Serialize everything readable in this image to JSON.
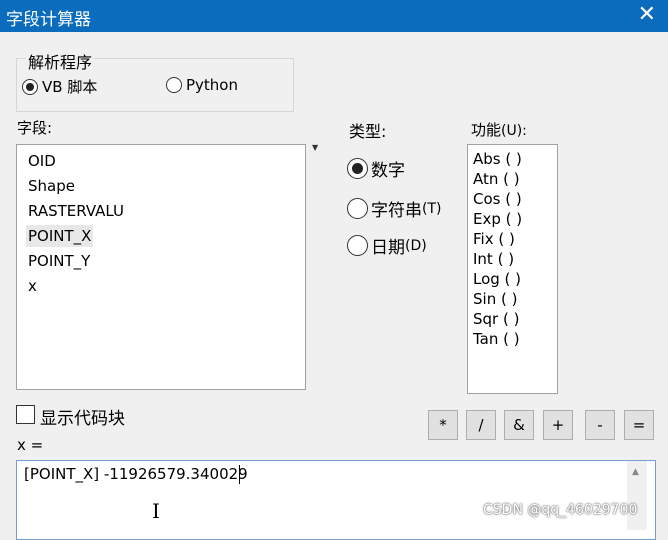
{
  "dialog": {
    "title": "字段计算器",
    "close_glyph": "✕"
  },
  "parser": {
    "legend": "解析程序",
    "options": [
      {
        "label": "VB 脚本",
        "selected": true
      },
      {
        "label": "Python",
        "selected": false
      }
    ]
  },
  "fields": {
    "label": "字段:",
    "items": [
      "OID",
      "Shape",
      "RASTERVALU",
      "POINT_X",
      "POINT_Y",
      "x"
    ],
    "selected": "POINT_X"
  },
  "type": {
    "label": "类型:",
    "options": [
      {
        "label": "数字",
        "selected": true
      },
      {
        "label": "字符串",
        "accel": "(T)",
        "selected": false
      },
      {
        "label": "日期",
        "accel": "(D)",
        "selected": false
      }
    ]
  },
  "functions": {
    "label": "功能",
    "accel": "(U):",
    "items": [
      "Abs ( )",
      "Atn ( )",
      "Cos ( )",
      "Exp ( )",
      "Fix ( )",
      "Int ( )",
      "Log ( )",
      "Sin ( )",
      "Sqr ( )",
      "Tan ( )"
    ]
  },
  "show_codeblock": {
    "label": "显示代码块",
    "checked": false
  },
  "operators": [
    "*",
    "/",
    "&",
    "+",
    "-",
    "="
  ],
  "expression": {
    "target_label": "x =",
    "value": "[POINT_X] -11926579.340029"
  },
  "watermark": "CSDN @qq_46029700",
  "colors": {
    "titlebar": "#0b6cbd",
    "window_bg": "#f0f0f0"
  }
}
